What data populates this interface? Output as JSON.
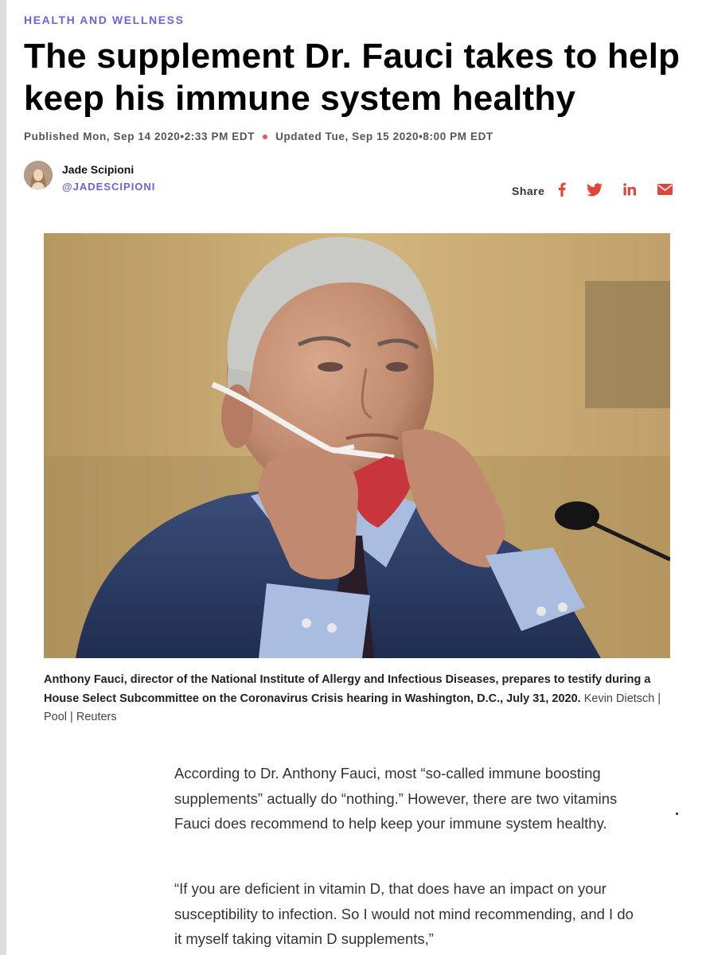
{
  "article": {
    "kicker": "HEALTH AND WELLNESS",
    "headline": "The supplement Dr. Fauci takes to help keep his immune system healthy",
    "published": "Published Mon, Sep 14 2020•2:33 PM EDT",
    "updated": "Updated Tue, Sep 15 2020•8:00 PM EDT"
  },
  "author": {
    "name": "Jade Scipioni",
    "handle": "@JADESCIPIONI"
  },
  "share": {
    "label": "Share",
    "icons": [
      "facebook-icon",
      "twitter-icon",
      "linkedin-icon",
      "email-icon"
    ],
    "color": "#e0453a"
  },
  "image": {
    "caption_bold": "Anthony Fauci, director of the National Institute of Allergy and Infectious Diseases, prepares to testify during a House Select Subcommittee on the Coronavirus Crisis hearing in Washington, D.C., July 31, 2020.",
    "credit": "Kevin Dietsch | Pool | Reuters"
  },
  "body": {
    "paragraphs": [
      "According to Dr. Anthony Fauci, most “so-called immune boosting supplements” actually do “nothing.” However, there are two vitamins Fauci does recommend to help keep your immune system healthy.",
      "“If you are deficient in vitamin D, that does have an impact on your susceptibility to infection. So I would not mind recommending, and I do it myself taking vitamin D supplements,”"
    ]
  },
  "colors": {
    "accent": "#6e62d8",
    "share": "#e0453a"
  }
}
